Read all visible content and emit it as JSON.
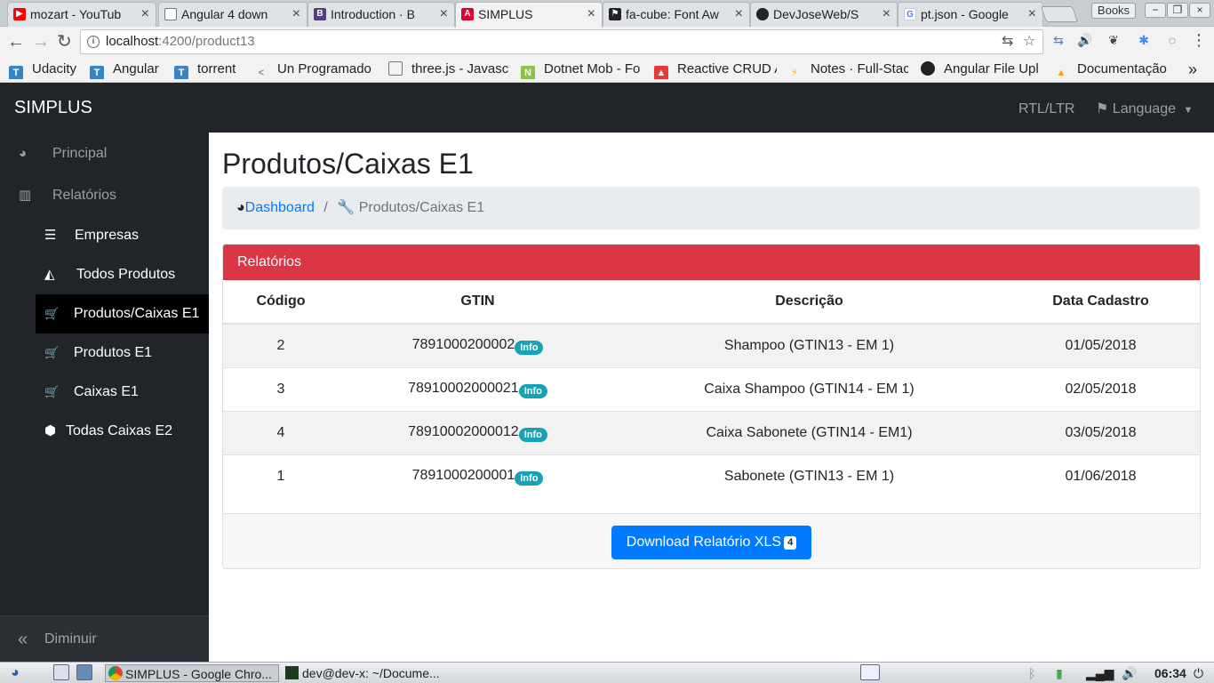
{
  "browser": {
    "tabs": [
      {
        "title": "mozart - YouTub",
        "icon": "youtube-icon",
        "color": "#ff0000",
        "glyph": "▶"
      },
      {
        "title": "Angular 4 down",
        "icon": "document-icon",
        "color": "#ffffff",
        "glyph": ""
      },
      {
        "title": "Introduction · B",
        "icon": "bootstrap-icon",
        "color": "#563d7c",
        "glyph": "B"
      },
      {
        "title": "SIMPLUS",
        "icon": "angular-icon",
        "color": "#dd0031",
        "glyph": "A"
      },
      {
        "title": "fa-cube: Font Aw",
        "icon": "flag-icon",
        "color": "#222222",
        "glyph": "⚑"
      },
      {
        "title": "DevJoseWeb/S",
        "icon": "github-icon",
        "color": "#222222",
        "glyph": "●"
      },
      {
        "title": "pt.json - Google",
        "icon": "google-icon",
        "color": "#4285f4",
        "glyph": "G"
      }
    ],
    "books_label": "Books",
    "url_host": "localhost",
    "url_path": ":4200/product13",
    "bookmarks": [
      {
        "label": "Udacity",
        "icon": "t-icon",
        "color": "#3b82c4",
        "glyph": "T"
      },
      {
        "label": "Angular",
        "icon": "t-icon",
        "color": "#3b82c4",
        "glyph": "T"
      },
      {
        "label": "torrent",
        "icon": "t-icon",
        "color": "#3b82c4",
        "glyph": "T"
      },
      {
        "label": "Un Programado",
        "icon": "code-icon",
        "color": "#888888",
        "glyph": "<"
      },
      {
        "label": "three.js - Javasc",
        "icon": "document-icon",
        "color": "#ffffff",
        "glyph": ""
      },
      {
        "label": "Dotnet Mob - Fo",
        "icon": "n-icon",
        "color": "#8bc34a",
        "glyph": "N"
      },
      {
        "label": "Reactive CRUD A",
        "icon": "fire-icon",
        "color": "#e53935",
        "glyph": "▲"
      },
      {
        "label": "Notes · Full-Stac",
        "icon": "bolt-icon",
        "color": "#f5b400",
        "glyph": "⚡"
      },
      {
        "label": "Angular File Upl",
        "icon": "github-icon",
        "color": "#222222",
        "glyph": "●"
      },
      {
        "label": "Documentação",
        "icon": "firebase-icon",
        "color": "#ffa000",
        "glyph": "▲"
      }
    ],
    "more_bookmarks": "»"
  },
  "app": {
    "brand": "SIMPLUS",
    "rtl_label": "RTL/LTR",
    "language_label": "Language"
  },
  "sidebar": {
    "items": [
      {
        "label": "Principal",
        "icon": "dashboard-icon",
        "glyph": "◕"
      },
      {
        "label": "Relatórios",
        "icon": "bar-chart-icon",
        "glyph": "▥"
      },
      {
        "label": "Empresas",
        "icon": "list-icon",
        "glyph": "☰"
      },
      {
        "label": "Todos Produtos",
        "icon": "area-chart-icon",
        "glyph": "◭"
      },
      {
        "label": "Produtos/Caixas E1",
        "icon": "cart-icon",
        "glyph": "🛒"
      },
      {
        "label": "Produtos E1",
        "icon": "cart-icon",
        "glyph": "🛒"
      },
      {
        "label": "Caixas E1",
        "icon": "cart-icon",
        "glyph": "🛒"
      },
      {
        "label": "Todas Caixas E2",
        "icon": "cube-icon",
        "glyph": "⬢"
      }
    ],
    "collapse_label": "Diminuir",
    "collapse_glyph": "«"
  },
  "page": {
    "title": "Produtos/Caixas E1",
    "breadcrumb_home": "Dashboard",
    "breadcrumb_sep": "/",
    "breadcrumb_current": "Produtos/Caixas E1"
  },
  "report": {
    "header": "Relatórios",
    "columns": [
      "Código",
      "GTIN",
      "Descrição",
      "Data Cadastro"
    ],
    "rows": [
      {
        "codigo": "2",
        "gtin": "7891000200002",
        "badge": "Info",
        "descricao": "Shampoo (GTIN13 - EM 1)",
        "data": "01/05/2018"
      },
      {
        "codigo": "3",
        "gtin": "78910002000021",
        "badge": "Info",
        "descricao": "Caixa Shampoo (GTIN14 - EM 1)",
        "data": "02/05/2018"
      },
      {
        "codigo": "4",
        "gtin": "78910002000012",
        "badge": "Info",
        "descricao": "Caixa Sabonete (GTIN14 - EM1)",
        "data": "03/05/2018"
      },
      {
        "codigo": "1",
        "gtin": "7891000200001",
        "badge": "Info",
        "descricao": "Sabonete (GTIN13 - EM 1)",
        "data": "01/06/2018"
      }
    ],
    "download_label": "Download Relatório XLS",
    "download_count": "4"
  },
  "taskbar": {
    "chrome_label": "SIMPLUS - Google Chro...",
    "terminal_label": "dev@dev-x: ~/Docume...",
    "clock": "06:34"
  },
  "colors": {
    "danger": "#dc3545",
    "primary": "#007bff",
    "info": "#17a2b8",
    "dark": "#212529"
  }
}
